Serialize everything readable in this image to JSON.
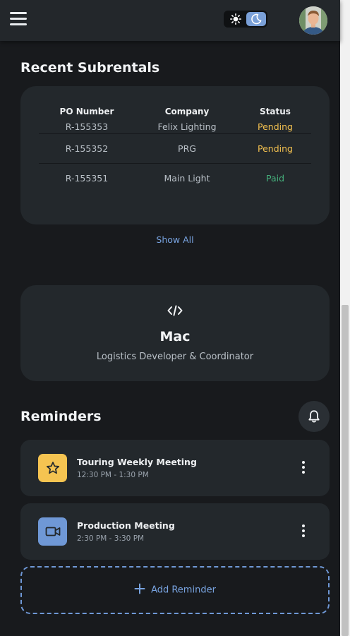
{
  "header": {
    "menu_icon": "hamburger-menu-icon",
    "theme": {
      "light_icon": "sun-icon",
      "dark_icon": "moon-icon",
      "active": "dark"
    },
    "avatar_icon": "user-avatar"
  },
  "subrentals": {
    "title": "Recent Subrentals",
    "columns": [
      "PO Number",
      "Company",
      "Status"
    ],
    "rows": [
      {
        "po": "R-155353",
        "company": "Felix Lighting",
        "status": "Pending"
      },
      {
        "po": "R-155352",
        "company": "PRG",
        "status": "Pending"
      },
      {
        "po": "R-155351",
        "company": "Main Light",
        "status": "Paid"
      }
    ],
    "show_all_label": "Show All",
    "status_colors": {
      "Pending": "#f2c04f",
      "Paid": "#45b07c"
    }
  },
  "profile": {
    "icon": "code-icon",
    "name": "Mac",
    "role": "Logistics Developer & Coordinator"
  },
  "reminders": {
    "title": "Reminders",
    "bell_icon": "bell-icon",
    "items": [
      {
        "title": "Touring Weekly Meeting",
        "time": "12:30 PM - 1:30 PM",
        "icon": "star-icon",
        "icon_bg": "#f5c451"
      },
      {
        "title": "Production Meeting",
        "time": "2:30 PM - 3:30 PM",
        "icon": "video-camera-icon",
        "icon_bg": "#6f98d6"
      }
    ],
    "add_label": "Add Reminder"
  },
  "colors": {
    "background": "#181a1d",
    "card": "#23282c",
    "accent": "#78a3e0"
  }
}
